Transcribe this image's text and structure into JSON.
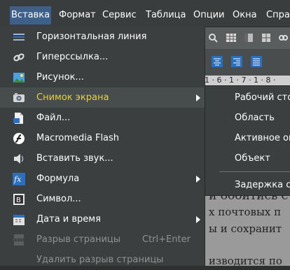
{
  "menubar": {
    "items": [
      "Вставка",
      "Формат",
      "Сервис",
      "Таблица",
      "Опции",
      "Окна",
      "Справ"
    ]
  },
  "insert_menu": {
    "items": [
      {
        "label": "Горизонтальная линия",
        "icon": "horizontal-line-icon"
      },
      {
        "label": "Гиперссылка...",
        "icon": "hyperlink-icon"
      },
      {
        "label": "Рисунок...",
        "icon": "picture-icon"
      },
      {
        "label": "Снимок экрана",
        "icon": "screenshot-icon",
        "highlighted": true,
        "submenu": true
      },
      {
        "label": "Файл...",
        "icon": "file-icon"
      },
      {
        "label": "Macromedia Flash",
        "icon": "flash-icon"
      },
      {
        "label": "Вставить звук...",
        "icon": "sound-icon"
      },
      {
        "label": "Формула",
        "icon": "formula-icon",
        "submenu": true
      },
      {
        "label": "Символ...",
        "icon": "symbol-icon"
      },
      {
        "label": "Дата и время",
        "icon": "date-time-icon",
        "submenu": true
      },
      {
        "label": "Разрыв страницы",
        "icon": "page-break-icon",
        "disabled": true,
        "shortcut": "Ctrl+Enter"
      },
      {
        "label": "Удалить разрыв страницы",
        "disabled": true
      }
    ]
  },
  "screenshot_submenu": {
    "items": [
      "Рабочий сто",
      "Область",
      "Активное ок",
      "Объект",
      "Задержка сн"
    ]
  },
  "document": {
    "ruler": "1 · 6 · 1 · 7 · 1 · 8 ·",
    "lines": [
      "и обойтись с",
      "х почтовых п",
      "ы и сохранит",
      "изводится по"
    ]
  },
  "colors": {
    "menu_bg": "#3b3f3f",
    "highlight_bg": "#474c4c",
    "highlight_text": "#e8d23a",
    "menubar_active": "#3d5f8a"
  }
}
